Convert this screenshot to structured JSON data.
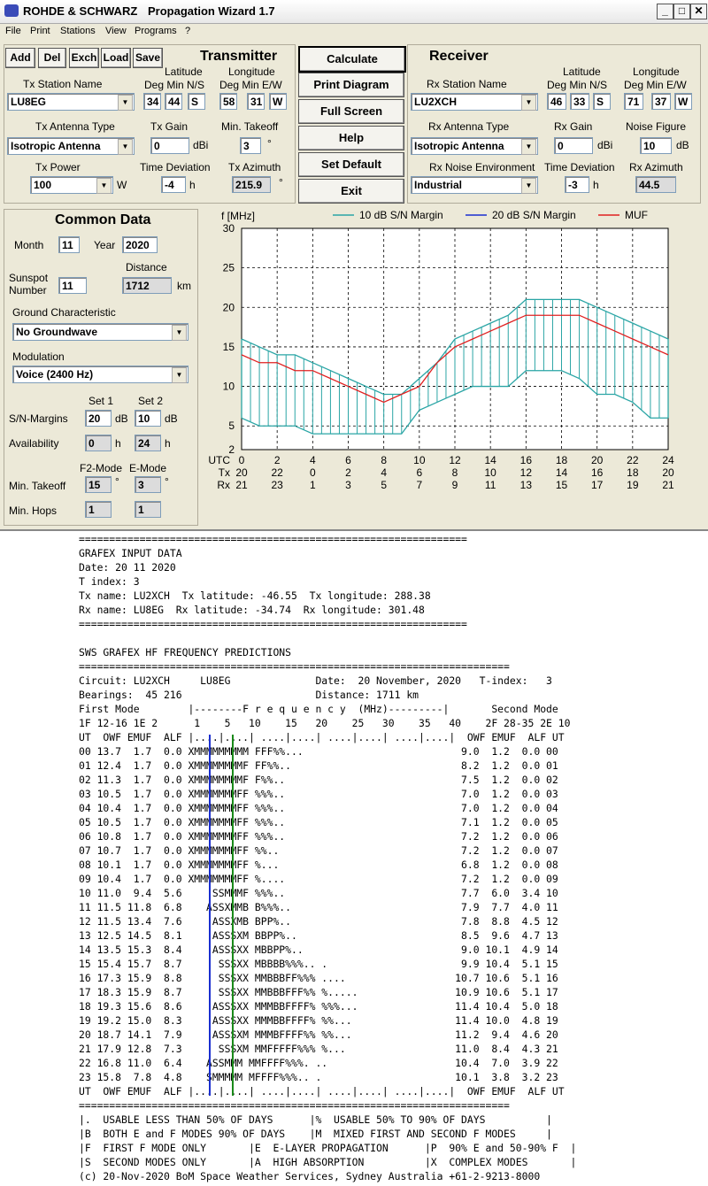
{
  "title": {
    "brand": "ROHDE & SCHWARZ",
    "app": "Propagation Wizard  1.7"
  },
  "menu": [
    "File",
    "Print",
    "Stations",
    "View",
    "Programs",
    "?"
  ],
  "toolbar": {
    "add": "Add",
    "del": "Del",
    "exch": "Exch",
    "load": "Load",
    "save": "Save"
  },
  "transmitter": {
    "heading": "Transmitter",
    "station_label": "Tx Station Name",
    "station": "LU8EG",
    "lat_label": "Latitude",
    "lon_label": "Longitude",
    "lat_sub": "Deg  Min  N/S",
    "lon_sub": "Deg  Min E/W",
    "lat_deg": "34",
    "lat_min": "44",
    "lat_ns": "S",
    "lon_deg": "58",
    "lon_min": "31",
    "lon_ew": "W",
    "antenna_label": "Tx Antenna Type",
    "antenna": "Isotropic Antenna",
    "gain_label": "Tx Gain",
    "gain": "0",
    "gain_unit": "dBi",
    "takeoff_label": "Min. Takeoff",
    "takeoff": "3",
    "takeoff_unit": "°",
    "power_label": "Tx Power",
    "power": "100",
    "power_unit": "W",
    "timedev_label": "Time Deviation",
    "timedev": "-4",
    "timedev_unit": "h",
    "azimuth_label": "Tx Azimuth",
    "azimuth": "215.9",
    "azimuth_unit": "°"
  },
  "receiver": {
    "heading": "Receiver",
    "station_label": "Rx Station Name",
    "station": "LU2XCH",
    "lat_label": "Latitude",
    "lon_label": "Longitude",
    "lat_sub": "Deg  Min  N/S",
    "lon_sub": "Deg  Min E/W",
    "lat_deg": "46",
    "lat_min": "33",
    "lat_ns": "S",
    "lon_deg": "71",
    "lon_min": "37",
    "lon_ew": "W",
    "antenna_label": "Rx Antenna Type",
    "antenna": "Isotropic Antenna",
    "gain_label": "Rx Gain",
    "gain": "0",
    "gain_unit": "dBi",
    "noise_label": "Noise Figure",
    "noise": "10",
    "noise_unit": "dB",
    "env_label": "Rx Noise Environment",
    "env": "Industrial",
    "timedev_label": "Time Deviation",
    "timedev": "-3",
    "timedev_unit": "h",
    "azimuth_label": "Rx Azimuth",
    "azimuth": "44.5",
    "azimuth_unit": "°"
  },
  "actions": {
    "calculate": "Calculate",
    "print": "Print Diagram",
    "full": "Full Screen",
    "help": "Help",
    "default": "Set Default",
    "exit": "Exit"
  },
  "common": {
    "heading": "Common Data",
    "month_label": "Month",
    "month": "11",
    "year_label": "Year",
    "year": "2020",
    "distance_label": "Distance",
    "distance": "1712",
    "distance_unit": "km",
    "sunspot_label1": "Sunspot",
    "sunspot_label2": "Number",
    "sunspot": "11",
    "ground_label": "Ground Characteristic",
    "ground": "No Groundwave",
    "modulation_label": "Modulation",
    "modulation": "Voice   (2400 Hz)",
    "set1": "Set 1",
    "set2": "Set 2",
    "sn_label": "S/N-Margins",
    "sn1": "20",
    "sn2": "10",
    "sn_unit": "dB",
    "avail_label": "Availability",
    "avail1": "0",
    "avail2": "24",
    "avail_unit": "h",
    "f2_label": "F2-Mode",
    "e_label": "E-Mode",
    "takeoff_label": "Min. Takeoff",
    "takeoff_f2": "15",
    "takeoff_e": "3",
    "takeoff_unit": "°",
    "hops_label": "Min. Hops",
    "hops_f2": "1",
    "hops_e": "1"
  },
  "chart_data": {
    "type": "line",
    "ylabel": "f [MHz]",
    "ylim": [
      2,
      30
    ],
    "yticks": [
      2,
      5,
      10,
      15,
      20,
      25,
      30
    ],
    "xlim": [
      0,
      24
    ],
    "xticks_utc": [
      0,
      2,
      4,
      6,
      8,
      10,
      12,
      14,
      16,
      18,
      20,
      22,
      24
    ],
    "xticks_tx": [
      20,
      22,
      0,
      2,
      4,
      6,
      8,
      10,
      12,
      14,
      16,
      18,
      20
    ],
    "xticks_rx": [
      21,
      23,
      1,
      3,
      5,
      7,
      9,
      11,
      13,
      15,
      17,
      19,
      21
    ],
    "row_labels": [
      "UTC",
      "Tx",
      "Rx"
    ],
    "grid": true,
    "legend_position": "top",
    "colors": {
      "margin10": "#2aa5a5",
      "margin20": "#1a2fd0",
      "muf": "#e02020"
    },
    "series": [
      {
        "name": "10 dB S/N Margin",
        "type": "band",
        "x": [
          0,
          1,
          2,
          3,
          4,
          5,
          6,
          7,
          8,
          9,
          10,
          11,
          12,
          13,
          14,
          15,
          16,
          17,
          18,
          19,
          20,
          21,
          22,
          23,
          24
        ],
        "upper": [
          16,
          15,
          14,
          14,
          13,
          12,
          11,
          10,
          9,
          9,
          11,
          13,
          16,
          17,
          18,
          19,
          21,
          21,
          21,
          21,
          20,
          19,
          18,
          17,
          16
        ],
        "lower": [
          6,
          5,
          5,
          5,
          4,
          4,
          4,
          4,
          4,
          4,
          7,
          8,
          9,
          10,
          10,
          10,
          12,
          12,
          12,
          11,
          9,
          9,
          8,
          6,
          6
        ]
      },
      {
        "name": "20 dB S/N Margin",
        "x": [],
        "y": []
      },
      {
        "name": "MUF",
        "x": [
          0,
          1,
          2,
          3,
          4,
          5,
          6,
          7,
          8,
          9,
          10,
          11,
          12,
          13,
          14,
          15,
          16,
          17,
          18,
          19,
          20,
          21,
          22,
          23,
          24
        ],
        "y": [
          14,
          13,
          13,
          12,
          12,
          11,
          10,
          9,
          8,
          9,
          10,
          13,
          15,
          16,
          17,
          18,
          19,
          19,
          19,
          19,
          18,
          17,
          16,
          15,
          14
        ]
      }
    ]
  },
  "report_lines": [
    "================================================================",
    "GRAFEX INPUT DATA",
    "Date: 20 11 2020",
    "T index: 3",
    "Tx name: LU2XCH  Tx latitude: -46.55  Tx longitude: 288.38",
    "Rx name: LU8EG  Rx latitude: -34.74  Rx longitude: 301.48",
    "================================================================",
    "",
    "SWS GRAFEX HF FREQUENCY PREDICTIONS",
    "=======================================================================",
    "Circuit: LU2XCH     LU8EG              Date:  20 November, 2020   T-index:   3",
    "Bearings:  45 216                      Distance: 1711 km",
    "First Mode        |--------F r e q u e n c y  (MHz)---------|       Second Mode",
    "1F 12-16 1E 2      1    5   10    15   20    25   30    35   40    2F 28-35 2E 10",
    "UT  OWF EMUF  ALF |....|....| ....|....| ....|....| ....|....|  OWF EMUF  ALF UT",
    "00 13.7  1.7  0.0 XMMMMMMMMM FFF%%...                          9.0  1.2  0.0 00",
    "01 12.4  1.7  0.0 XMMMMMMMMF FF%%..                            8.2  1.2  0.0 01",
    "02 11.3  1.7  0.0 XMMMMMMMMF F%%..                             7.5  1.2  0.0 02",
    "03 10.5  1.7  0.0 XMMMMMMMFF %%%..                             7.0  1.2  0.0 03",
    "04 10.4  1.7  0.0 XMMMMMMMFF %%%..                             7.0  1.2  0.0 04",
    "05 10.5  1.7  0.0 XMMMMMMMFF %%%..                             7.1  1.2  0.0 05",
    "06 10.8  1.7  0.0 XMMMMMMMFF %%%..                             7.2  1.2  0.0 06",
    "07 10.7  1.7  0.0 XMMMMMMMFF %%..                              7.2  1.2  0.0 07",
    "08 10.1  1.7  0.0 XMMMMMMMFF %...                              6.8  1.2  0.0 08",
    "09 10.4  1.7  0.0 XMMMMMMMFF %....                             7.2  1.2  0.0 09",
    "10 11.0  9.4  5.6     SSMMMF %%%..                             7.7  6.0  3.4 10",
    "11 11.5 11.8  6.8    ASSXMMB B%%%..                            7.9  7.7  4.0 11",
    "12 11.5 13.4  7.6     ASSXMB BPP%..                            7.8  8.8  4.5 12",
    "13 12.5 14.5  8.1     ASSSXM BBPP%..                           8.5  9.6  4.7 13",
    "14 13.5 15.3  8.4     ASSSXX MBBPP%..                          9.0 10.1  4.9 14",
    "15 15.4 15.7  8.7      SSSXX MBBBB%%%.. .                      9.9 10.4  5.1 15",
    "16 17.3 15.9  8.8      SSSXX MMBBBFF%%% ....                  10.7 10.6  5.1 16",
    "17 18.3 15.9  8.7      SSSXX MMBBBFFF%% %.....                10.9 10.6  5.1 17",
    "18 19.3 15.6  8.6     ASSSXX MMMBBFFFF% %%%...                11.4 10.4  5.0 18",
    "19 19.2 15.0  8.3     ASSSXX MMMBBFFFF% %%...                 11.4 10.0  4.8 19",
    "20 18.7 14.1  7.9     ASSSXM MMMBFFFF%% %%...                 11.2  9.4  4.6 20",
    "21 17.9 12.8  7.3      SSSXM MMFFFFF%%% %...                  11.0  8.4  4.3 21",
    "22 16.8 11.0  6.4    ASSMMM MMFFFF%%%. ..                     10.4  7.0  3.9 22",
    "23 15.8  7.8  4.8    SMMMMM MFFFF%%%.. .                      10.1  3.8  3.2 23",
    "UT  OWF EMUF  ALF |....|....| ....|....| ....|....| ....|....|  OWF EMUF  ALF UT",
    "=======================================================================",
    "|.  USABLE LESS THAN 50% OF DAYS      |%  USABLE 50% TO 90% OF DAYS          |",
    "|B  BOTH E and F MODES 90% OF DAYS    |M  MIXED FIRST AND SECOND F MODES     |",
    "|F  FIRST F MODE ONLY       |E  E-LAYER PROPAGATION      |P  90% E and 50-90% F  |",
    "|S  SECOND MODES ONLY       |A  HIGH ABSORPTION          |X  COMPLEX MODES       |",
    "(c) 20-Nov-2020 BoM Space Weather Services, Sydney Australia +61-2-9213-8000"
  ]
}
